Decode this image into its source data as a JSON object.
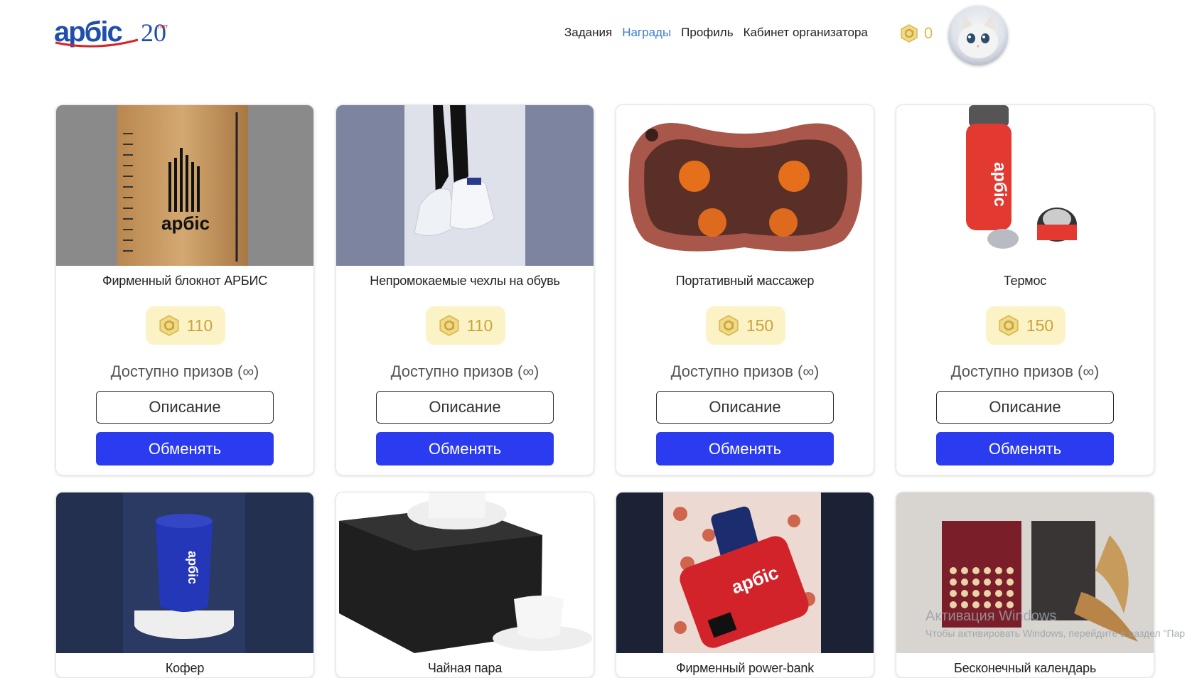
{
  "header": {
    "nav": [
      {
        "label": "Задания",
        "active": false
      },
      {
        "label": "Награды",
        "active": true
      },
      {
        "label": "Профиль",
        "active": false
      },
      {
        "label": "Кабинет организатора",
        "active": false
      }
    ],
    "balance": "0",
    "accent_color": "#3d7dcf",
    "coin_color": "#d9b94e"
  },
  "logo": {
    "text": "арбис",
    "badge": "20 лет"
  },
  "cards": [
    {
      "title": "Фирменный блокнот АРБИС",
      "price": "110",
      "available": "Доступно призов (∞)",
      "describe": "Описание",
      "exchange": "Обменять"
    },
    {
      "title": "Непромокаемые чехлы на обувь",
      "price": "110",
      "available": "Доступно призов (∞)",
      "describe": "Описание",
      "exchange": "Обменять"
    },
    {
      "title": "Портативный массажер",
      "price": "150",
      "available": "Доступно призов (∞)",
      "describe": "Описание",
      "exchange": "Обменять"
    },
    {
      "title": "Термос",
      "price": "150",
      "available": "Доступно призов (∞)",
      "describe": "Описание",
      "exchange": "Обменять"
    },
    {
      "title": "Кофер",
      "price": "",
      "available": "",
      "describe": "",
      "exchange": ""
    },
    {
      "title": "Чайная пара",
      "price": "",
      "available": "",
      "describe": "",
      "exchange": ""
    },
    {
      "title": "Фирменный power-bank",
      "price": "",
      "available": "",
      "describe": "",
      "exchange": ""
    },
    {
      "title": "Бесконечный календарь",
      "price": "",
      "available": "",
      "describe": "",
      "exchange": ""
    }
  ],
  "watermark": {
    "line1": "Активация Windows",
    "line2": "Чтобы активировать Windows, перейдите в раздел \"Пар"
  },
  "button_color": "#2b3cf0"
}
